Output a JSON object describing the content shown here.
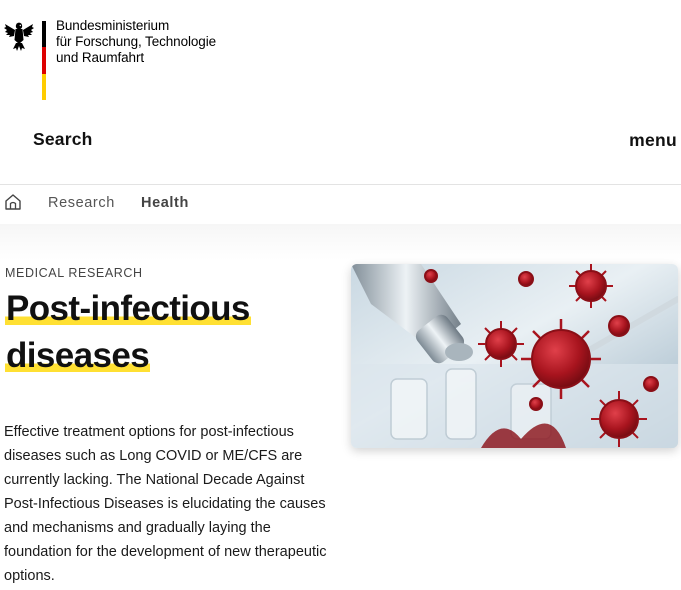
{
  "header": {
    "ministry_lines": [
      "Bundesministerium",
      "für Forschung, Technologie",
      "und Raumfahrt"
    ],
    "search_label": "Search",
    "menu_label": "menu",
    "flag_colors": [
      "#000000",
      "#dd0000",
      "#ffcc00"
    ]
  },
  "breadcrumb": {
    "home_icon": "home-icon",
    "items": [
      "Research",
      "Health"
    ]
  },
  "main": {
    "eyebrow": "MEDICAL RESEARCH",
    "title_line1": "Post-infectious",
    "title_line2": "diseases",
    "highlight_color": "#ffe033",
    "intro": "Effective treatment options for post-infectious diseases such as Long COVID or ME/CFS are currently lacking. The National Decade Against Post-Infectious Diseases is elucidating the causes and mechanisms and gradually laying the foundation for the development of new therapeutic options."
  }
}
